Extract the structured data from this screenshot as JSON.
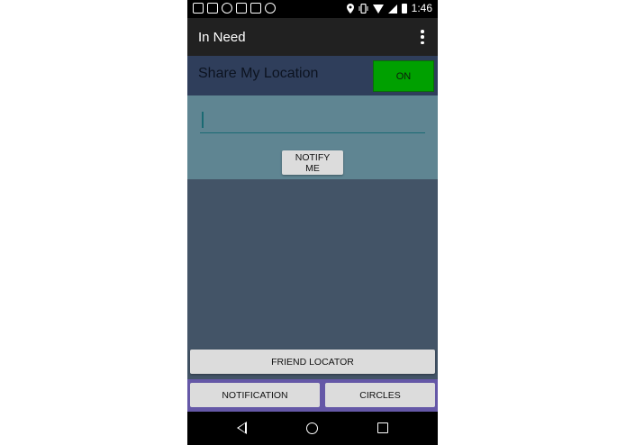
{
  "status_bar": {
    "time": "1:46",
    "left_icons": [
      "messenger-icon",
      "image-icon",
      "missed-call-icon",
      "hangouts-icon",
      "contacts-icon",
      "whatsapp-icon"
    ],
    "right_icons": [
      "location-pin-icon",
      "vibrate-icon",
      "wifi-icon",
      "signal-icon",
      "battery-icon"
    ]
  },
  "app_bar": {
    "title": "In Need",
    "overflow_icon": "more-vert-icon"
  },
  "share_location": {
    "label": "Share My Location",
    "toggle_label": "ON",
    "toggle_color": "#00a000"
  },
  "message_input": {
    "value": "",
    "placeholder": ""
  },
  "buttons": {
    "notify": "NOTIFY ME",
    "friend_locator": "FRIEND LOCATOR",
    "notification": "NOTIFICATION",
    "circles": "CIRCLES"
  },
  "nav_bar": {
    "back_icon": "back-icon",
    "home_icon": "home-icon",
    "recents_icon": "recents-icon"
  },
  "colors": {
    "background": "#435467",
    "app_bar": "#212121",
    "share_row": "#2f3e5b",
    "input_panel": "#5f8592",
    "bottom_tabs": "#6558a7"
  }
}
